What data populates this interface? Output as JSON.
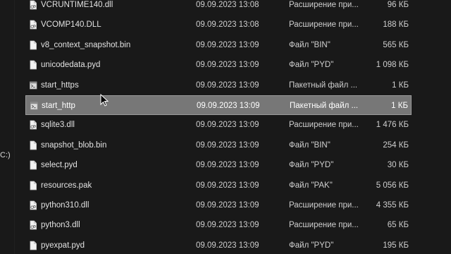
{
  "nav": {
    "drive_fragment": "C:)"
  },
  "files": [
    {
      "name": "VCRUNTIME140.dll",
      "date": "09.09.2023 13:08",
      "type": "Расширение при...",
      "size": "96 КБ",
      "icon": "dll-icon"
    },
    {
      "name": "VCOMP140.DLL",
      "date": "09.09.2023 13:08",
      "type": "Расширение при...",
      "size": "188 КБ",
      "icon": "dll-icon"
    },
    {
      "name": "v8_context_snapshot.bin",
      "date": "09.09.2023 13:09",
      "type": "Файл \"BIN\"",
      "size": "565 КБ",
      "icon": "file-icon"
    },
    {
      "name": "unicodedata.pyd",
      "date": "09.09.2023 13:09",
      "type": "Файл \"PYD\"",
      "size": "1 098 КБ",
      "icon": "file-icon"
    },
    {
      "name": "start_https",
      "date": "09.09.2023 13:09",
      "type": "Пакетный файл ...",
      "size": "1 КБ",
      "icon": "batch-file-icon"
    },
    {
      "name": "start_http",
      "date": "09.09.2023 13:09",
      "type": "Пакетный файл ...",
      "size": "1 КБ",
      "icon": "batch-file-icon",
      "selected": true
    },
    {
      "name": "sqlite3.dll",
      "date": "09.09.2023 13:09",
      "type": "Расширение при...",
      "size": "1 476 КБ",
      "icon": "dll-icon"
    },
    {
      "name": "snapshot_blob.bin",
      "date": "09.09.2023 13:09",
      "type": "Файл \"BIN\"",
      "size": "254 КБ",
      "icon": "file-icon"
    },
    {
      "name": "select.pyd",
      "date": "09.09.2023 13:09",
      "type": "Файл \"PYD\"",
      "size": "30 КБ",
      "icon": "file-icon"
    },
    {
      "name": "resources.pak",
      "date": "09.09.2023 13:09",
      "type": "Файл \"PAK\"",
      "size": "5 056 КБ",
      "icon": "file-icon"
    },
    {
      "name": "python310.dll",
      "date": "09.09.2023 13:09",
      "type": "Расширение при...",
      "size": "4 355 КБ",
      "icon": "dll-icon"
    },
    {
      "name": "python3.dll",
      "date": "09.09.2023 13:09",
      "type": "Расширение при...",
      "size": "65 КБ",
      "icon": "dll-icon"
    },
    {
      "name": "pyexpat.pyd",
      "date": "09.09.2023 13:09",
      "type": "Файл \"PYD\"",
      "size": "195 КБ",
      "icon": "file-icon"
    }
  ]
}
